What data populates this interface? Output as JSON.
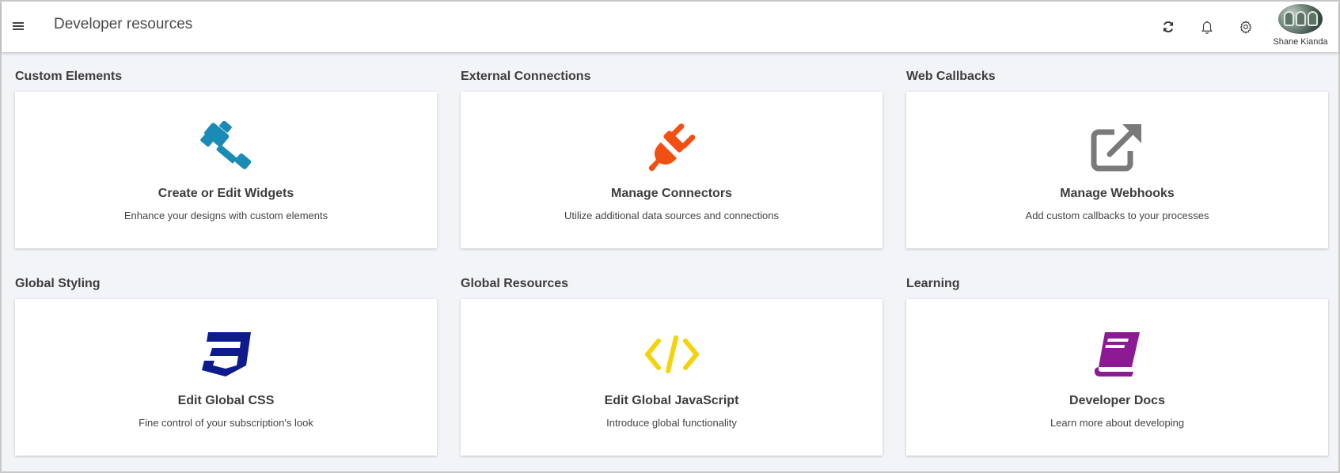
{
  "header": {
    "title": "Developer resources",
    "user_name": "Shane Kianda"
  },
  "icons": {
    "menu": "hamburger-icon",
    "refresh": "refresh-icon",
    "notifications": "bell-icon",
    "settings": "gear-icon"
  },
  "sections": [
    {
      "heading": "Custom Elements",
      "card_title": "Create or Edit Widgets",
      "card_desc": "Enhance your designs with custom elements",
      "icon": "gavel-icon",
      "icon_color": "#1a8bb5"
    },
    {
      "heading": "External Connections",
      "card_title": "Manage Connectors",
      "card_desc": "Utilize additional data sources and connections",
      "icon": "plug-icon",
      "icon_color": "#f34f12"
    },
    {
      "heading": "Web Callbacks",
      "card_title": "Manage Webhooks",
      "card_desc": "Add custom callbacks to your processes",
      "icon": "external-link-icon",
      "icon_color": "#7a7a7a"
    },
    {
      "heading": "Global Styling",
      "card_title": "Edit Global CSS",
      "card_desc": "Fine control of your subscription's look",
      "icon": "css3-icon",
      "icon_color": "#0f1b8c"
    },
    {
      "heading": "Global Resources",
      "card_title": "Edit Global JavaScript",
      "card_desc": "Introduce global functionality",
      "icon": "code-icon",
      "icon_color": "#f5d20a"
    },
    {
      "heading": "Learning",
      "card_title": "Developer Docs",
      "card_desc": "Learn more about developing",
      "icon": "book-icon",
      "icon_color": "#8b1a93"
    }
  ]
}
